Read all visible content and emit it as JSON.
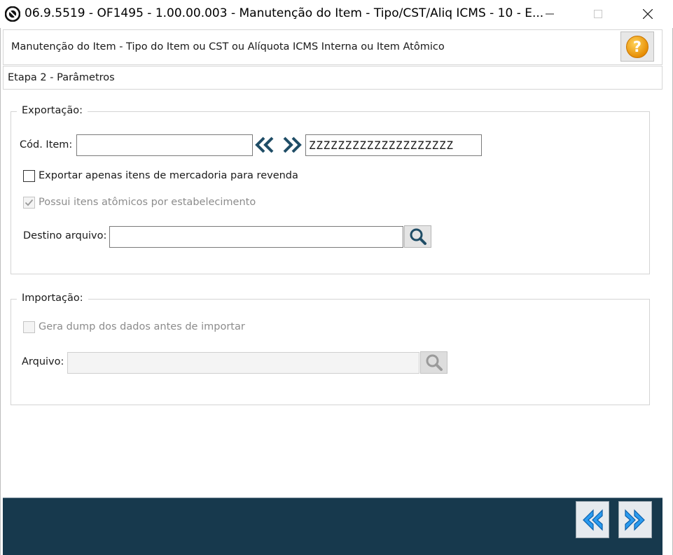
{
  "window": {
    "title": "06.9.5519 - OF1495 - 1.00.00.003 - Manutenção do Item - Tipo/CST/Aliq ICMS - 10 - E..."
  },
  "header": {
    "title": "Manutenção do Item - Tipo do Item ou CST ou Alíquota ICMS Interna ou Item Atômico",
    "help_icon": "question-circle-icon"
  },
  "step": {
    "label": "Etapa 2 - Parâmetros"
  },
  "export": {
    "legend": "Exportação:",
    "cod_item_label": "Cód. Item:",
    "cod_item_from": "",
    "cod_item_to": "ZZZZZZZZZZZZZZZZZZZZ",
    "only_resale_label": "Exportar apenas itens de mercadoria para revenda",
    "only_resale_checked": false,
    "atomic_label": "Possui itens atômicos por estabelecimento",
    "atomic_checked": true,
    "atomic_enabled": false,
    "destino_label": "Destino arquivo:",
    "destino_value": ""
  },
  "import": {
    "legend": "Importação:",
    "dump_label": "Gera dump dos dados antes de importar",
    "dump_checked": false,
    "dump_enabled": false,
    "arquivo_label": "Arquivo:",
    "arquivo_value": ""
  },
  "footer": {
    "prev_icon": "double-chevron-left-icon",
    "next_icon": "double-chevron-right-icon"
  },
  "colors": {
    "footer_bg": "#17394d",
    "accent_blue": "#1e8fe0",
    "help_orange": "#f5a300"
  }
}
